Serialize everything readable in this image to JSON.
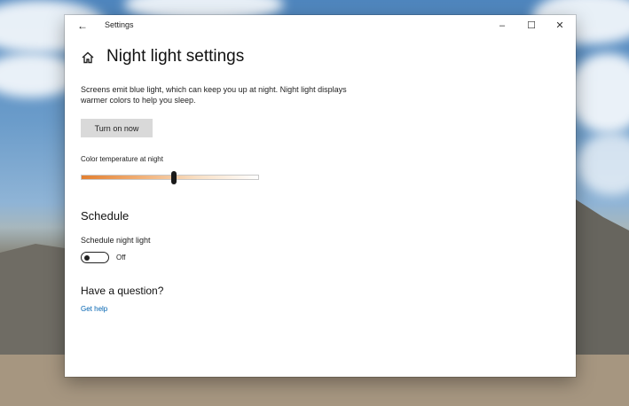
{
  "window": {
    "title": "Settings",
    "controls": {
      "minimize": "–",
      "maximize": "☐",
      "close": "✕"
    }
  },
  "icons": {
    "back": "back-arrow-icon",
    "home": "home-icon"
  },
  "page": {
    "title": "Night light settings",
    "description": "Screens emit blue light, which can keep you up at night. Night light displays warmer colors to help you sleep.",
    "turn_on_button": "Turn on now"
  },
  "color_temperature": {
    "label": "Color temperature at night",
    "level": 0.52,
    "colors": {
      "warm": "#e37f2f",
      "cool": "#ffffff"
    }
  },
  "schedule": {
    "heading": "Schedule",
    "toggle_label": "Schedule night light",
    "toggle_state": "Off",
    "toggle_on": false
  },
  "help": {
    "heading": "Have a question?",
    "link": "Get help"
  },
  "colors": {
    "link": "#0063b1",
    "button_bg": "#d9d9d9"
  }
}
